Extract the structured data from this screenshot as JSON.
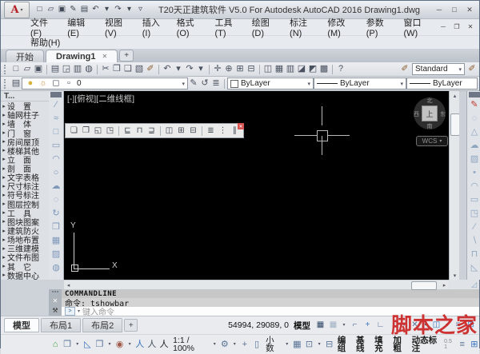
{
  "window": {
    "title": "T20天正建筑软件 V5.0 For Autodesk AutoCAD 2016   Drawing1.dwg",
    "logo_letter": "A",
    "logo_dropdown_icon": "▾",
    "qat": [
      {
        "name": "qat-new-icon",
        "text": "□"
      },
      {
        "name": "qat-open-icon",
        "text": "▱"
      },
      {
        "name": "qat-save-icon",
        "text": "▣"
      },
      {
        "name": "qat-saveas-icon",
        "text": "✎"
      },
      {
        "name": "qat-plot-icon",
        "text": "▤"
      },
      {
        "name": "qat-undo-icon",
        "text": "↶"
      },
      {
        "name": "qat-undo-dropdown-icon",
        "text": "▾"
      },
      {
        "name": "qat-redo-icon",
        "text": "↷"
      },
      {
        "name": "qat-redo-dropdown-icon",
        "text": "▾"
      },
      {
        "name": "qat-customize-icon",
        "text": "▿"
      }
    ],
    "controls": [
      {
        "name": "minimize-button",
        "text": "─"
      },
      {
        "name": "maximize-button",
        "text": "□"
      },
      {
        "name": "close-button",
        "text": "✕"
      }
    ],
    "doc_controls": [
      {
        "name": "doc-minimize-button",
        "text": "─"
      },
      {
        "name": "doc-restore-button",
        "text": "❐"
      },
      {
        "name": "doc-close-button",
        "text": "✕"
      }
    ]
  },
  "menu": {
    "items": [
      {
        "name": "menu-file",
        "text": "文件(F)"
      },
      {
        "name": "menu-edit",
        "text": "编辑(E)"
      },
      {
        "name": "menu-view",
        "text": "视图(V)"
      },
      {
        "name": "menu-insert",
        "text": "插入(I)"
      },
      {
        "name": "menu-format",
        "text": "格式(O)"
      },
      {
        "name": "menu-tools",
        "text": "工具(T)"
      },
      {
        "name": "menu-draw",
        "text": "绘图(D)"
      },
      {
        "name": "menu-dimension",
        "text": "标注(N)"
      },
      {
        "name": "menu-modify",
        "text": "修改(M)"
      },
      {
        "name": "menu-parameters",
        "text": "参数(P)"
      },
      {
        "name": "menu-window",
        "text": "窗口(W)"
      }
    ],
    "row2": [
      {
        "name": "menu-help",
        "text": "帮助(H)"
      }
    ]
  },
  "file_tabs": {
    "start_label": "开始",
    "drawing_label": "Drawing1",
    "close_icon": "✕",
    "new_tab_icon": "+"
  },
  "toolbar_standard": {
    "icons": [
      {
        "name": "new-icon",
        "text": "□"
      },
      {
        "name": "open-icon",
        "text": "▱"
      },
      {
        "name": "save-icon",
        "text": "▣"
      },
      {
        "sep": true
      },
      {
        "name": "print-icon",
        "text": "▤"
      },
      {
        "name": "print-preview-icon",
        "text": "◲"
      },
      {
        "name": "publish-icon",
        "text": "▥"
      },
      {
        "name": "etransmit-icon",
        "text": "◍"
      },
      {
        "sep": true
      },
      {
        "name": "cut-icon",
        "text": "✂"
      },
      {
        "name": "copy-icon",
        "text": "❐"
      },
      {
        "name": "paste-icon",
        "text": "❑"
      },
      {
        "name": "match-properties-icon",
        "text": "▧"
      },
      {
        "name": "blockeditor-icon",
        "text": "✐",
        "color": "#8a5a2b"
      },
      {
        "sep": true
      },
      {
        "name": "undo-icon",
        "text": "↶"
      },
      {
        "name": "undo-dropdown-icon",
        "text": "▾"
      },
      {
        "name": "redo-icon",
        "text": "↷"
      },
      {
        "name": "redo-dropdown-icon",
        "text": "▾"
      },
      {
        "sep": true
      },
      {
        "name": "pan-icon",
        "text": "✛"
      },
      {
        "name": "zoom-realtime-icon",
        "text": "⊕"
      },
      {
        "name": "zoom-window-icon",
        "text": "⊞"
      },
      {
        "name": "zoom-previous-icon",
        "text": "⊟"
      },
      {
        "sep": true
      },
      {
        "name": "properties-icon",
        "text": "◫"
      },
      {
        "name": "designcenter-icon",
        "text": "▦"
      },
      {
        "name": "toolpalettes-icon",
        "text": "▥"
      },
      {
        "name": "sheetset-icon",
        "text": "◪"
      },
      {
        "name": "markup-icon",
        "text": "◩"
      },
      {
        "name": "quickcalc-icon",
        "text": "▩"
      },
      {
        "sep": true
      },
      {
        "name": "help-icon",
        "text": "?"
      }
    ],
    "brush_left_icon": "✐",
    "style_value": "Standard",
    "style_dropdown_icon": "▾",
    "brush_right_icon": "✐"
  },
  "toolbar_properties": {
    "layer_manager_icon": "▤",
    "layer_swatch_icons": [
      {
        "name": "bulb-icon",
        "text": "●",
        "color": "#d9b23c",
        "ia": false
      },
      {
        "name": "sun-icon",
        "text": "☼",
        "color": "#d98e3c",
        "ia": false
      },
      {
        "name": "lock-icon",
        "text": "◻",
        "ia": false
      },
      {
        "name": "color-swatch",
        "text": "▫",
        "ia": false
      }
    ],
    "layer_value": "0",
    "make_layer_current_icon": "✎",
    "layer_previous_icon": "↺",
    "layer_states_icon": "≣",
    "color_value": "ByLayer",
    "linetype_value": "ByLayer",
    "lineweight_value": "ByLayer"
  },
  "sidebar": {
    "title": "T...",
    "arrow_icon": "▸",
    "items": [
      "设　置",
      "轴网柱子",
      "墙　体",
      "门　窗",
      "房间屋顶",
      "楼梯其他",
      "立　面",
      "剖　面",
      "文字表格",
      "尺寸标注",
      "符号标注",
      "图层控制",
      "工　具",
      "图块图案",
      "建筑防火",
      "场地布置",
      "三维建模",
      "文件布图",
      "其　它",
      "数据中心"
    ]
  },
  "draw_toolbar": {
    "icons": [
      {
        "name": "line-icon",
        "text": "∕"
      },
      {
        "name": "spline-icon",
        "text": "≈"
      },
      {
        "name": "rect-icon",
        "text": "□"
      },
      {
        "name": "polygon-icon",
        "text": "▭"
      },
      {
        "name": "arc-icon",
        "text": "◠"
      },
      {
        "name": "circle-icon",
        "text": "○"
      },
      {
        "name": "revcloud-icon",
        "text": "☁"
      },
      {
        "name": "ellipse-icon",
        "text": "◌"
      },
      {
        "name": "rotate-icon",
        "text": "↻"
      },
      {
        "name": "copy-icon",
        "text": "❐"
      },
      {
        "name": "array-icon",
        "text": "▦"
      },
      {
        "name": "hatch-icon",
        "text": "▨"
      },
      {
        "name": "gradient-icon",
        "text": "◍"
      }
    ]
  },
  "modify_toolbar": {
    "icons": [
      {
        "name": "pencil-icon",
        "text": "✎",
        "color": "#c0392b"
      },
      {
        "name": "erase-icon",
        "text": "◌"
      },
      {
        "name": "mirror-icon",
        "text": "△"
      },
      {
        "name": "cloud-icon",
        "text": "☁"
      },
      {
        "name": "hatch-icon",
        "text": "▨"
      },
      {
        "name": "point-icon",
        "text": "•"
      },
      {
        "name": "arc-icon",
        "text": "◠"
      },
      {
        "name": "rect-icon",
        "text": "▭"
      },
      {
        "name": "move-icon",
        "text": "◳"
      },
      {
        "name": "trim-icon",
        "text": "∕"
      },
      {
        "name": "extend-icon",
        "text": "∖"
      },
      {
        "name": "offset-icon",
        "text": "⊓"
      },
      {
        "name": "corner-icon",
        "text": "◺"
      }
    ]
  },
  "canvas": {
    "viewport_label": "[-][俯视][二维线框]",
    "float_toolbar": {
      "close_icon": "✕",
      "icons": [
        {
          "name": "object-copy-icon",
          "text": "❏"
        },
        {
          "name": "object-move-icon",
          "text": "❐"
        },
        {
          "name": "align-bottom-icon",
          "text": "◱"
        },
        {
          "name": "align-top-icon",
          "text": "◳"
        },
        {
          "sep": true
        },
        {
          "name": "align-left-icon",
          "text": "⊑"
        },
        {
          "name": "align-center-icon",
          "text": "⊓"
        },
        {
          "name": "align-right-icon",
          "text": "⊒"
        },
        {
          "sep": true
        },
        {
          "name": "distribute-h-icon",
          "text": "◫"
        },
        {
          "name": "distribute-v-icon",
          "text": "⊞"
        },
        {
          "name": "equal-space-icon",
          "text": "⊟"
        },
        {
          "sep": true
        },
        {
          "name": "list-icon",
          "text": "≣"
        },
        {
          "name": "columns-icon",
          "text": "⋮"
        },
        {
          "name": "parallel-icon",
          "text": "∥"
        }
      ]
    },
    "ucs": {
      "x_label": "X",
      "y_label": "Y"
    },
    "viewcube": {
      "top": "上",
      "north": "北",
      "south": "南",
      "east": "东",
      "west": "西"
    },
    "wcs_label": "WCS",
    "wcs_dropdown_icon": "▾"
  },
  "scrollbars": {
    "up_icon": "▴",
    "down_icon": "▾",
    "left_icon": "◂",
    "right_icon": "▸",
    "corner_icon": "◿"
  },
  "commandline": {
    "close_icon": "✕",
    "customize_icon": "⚒",
    "title": "COMMANDLINE",
    "history": "命令: tshowbar",
    "prompt_icon": ">",
    "dropdown_icon": "▾",
    "placeholder": "键入命令"
  },
  "layout_tabs": {
    "tabs": [
      "模型",
      "布局1",
      "布局2"
    ],
    "new_layout_icon": "+"
  },
  "status": {
    "coords": "54994, 29089, 0",
    "model_label": "模型",
    "right_icons": [
      {
        "name": "grid-display-icon",
        "text": "▦",
        "color": "#2d4564"
      },
      {
        "name": "snap-grid-icon",
        "text": "▦",
        "color": "#9fb0c2"
      },
      {
        "name": "grid-dropdown-icon",
        "text": "▾",
        "cls": "dd2"
      },
      {
        "name": "snap-mode-icon",
        "text": "⌐"
      },
      {
        "name": "dynamic-input-icon",
        "text": "+",
        "color": "#3a74c0"
      },
      {
        "name": "ortho-icon",
        "text": "∟"
      },
      {
        "name": "polar-tracking-icon",
        "text": "◔"
      },
      {
        "name": "polar-dropdown-icon",
        "text": "▾",
        "cls": "dd2"
      },
      {
        "name": "osnap-icon",
        "text": "✕"
      },
      {
        "name": "osnap-dropdown-icon",
        "text": "▾",
        "cls": "dd2"
      },
      {
        "name": "annotation-visibility-icon",
        "text": "◫",
        "color": "#3a74c0"
      },
      {
        "name": "annotation-dropdown-icon",
        "text": "▾",
        "cls": "dd2"
      },
      {
        "name": "customization-icon",
        "text": "≡"
      },
      {
        "name": "clean-screen-icon",
        "text": "⊞",
        "color": "#3a74c0"
      }
    ],
    "row2_icons": [
      {
        "name": "tz-object-icon",
        "text": "⌂",
        "color": "#3f9e3f"
      },
      {
        "name": "workspace-icon",
        "text": "❒"
      },
      {
        "name": "workspace-dropdown-icon",
        "text": "▾",
        "cls": "dd2"
      },
      {
        "name": "tz-view-icon",
        "text": "◺",
        "color": "#3a74c0"
      },
      {
        "name": "box-mode-icon",
        "text": "❒"
      },
      {
        "name": "box-dropdown-icon",
        "text": "▾",
        "cls": "dd2"
      },
      {
        "name": "visual-style-icon",
        "text": "◉",
        "color": "#a05a4a"
      },
      {
        "name": "visual-dropdown-icon",
        "text": "▾",
        "cls": "dd2"
      },
      {
        "name": "walk-icon-1",
        "text": "人",
        "color": "#3a74c0"
      },
      {
        "name": "walk-icon-2",
        "text": "人",
        "color": "#44505e"
      },
      {
        "name": "walk-icon-3",
        "text": "人",
        "color": "#222"
      },
      {
        "name": "scale-label",
        "text": "1:1 / 100%",
        "cls": "txtb"
      },
      {
        "name": "scale-dropdown-icon",
        "text": "▾",
        "cls": "dd2"
      },
      {
        "name": "gear-icon",
        "text": "⚙"
      },
      {
        "name": "gear-dropdown-icon",
        "text": "▾",
        "cls": "dd2"
      },
      {
        "name": "add-scale-icon",
        "text": "+"
      },
      {
        "name": "isolate-icon",
        "text": "▯"
      },
      {
        "name": "precision-label",
        "text": "小数",
        "cls": "txtb"
      },
      {
        "name": "precision-dropdown-icon",
        "text": "▾",
        "cls": "dd2"
      },
      {
        "name": "calc-icon",
        "text": "▦"
      },
      {
        "name": "monitor-icon",
        "text": "⊡"
      },
      {
        "name": "monitor-dropdown-icon",
        "text": "▾",
        "cls": "dd2"
      },
      {
        "name": "tz-status-icon",
        "text": "⊟"
      },
      {
        "name": "toggle-group",
        "text": "编组",
        "cls": "tgl"
      },
      {
        "name": "toggle-baseline",
        "text": "基线",
        "cls": "tgl"
      },
      {
        "name": "toggle-fill",
        "text": "填充",
        "cls": "tgl"
      },
      {
        "name": "toggle-bold",
        "text": "加粗",
        "cls": "tgl"
      },
      {
        "name": "toggle-dynamic-dim",
        "text": "动态标注",
        "cls": "tgl"
      },
      {
        "name": "annotation-scale-values",
        "text": "0.5 1",
        "cls": "tiny",
        "ia": false
      },
      {
        "name": "hamburger-icon",
        "text": "≡"
      },
      {
        "name": "fullscreen-icon",
        "text": "⊞",
        "color": "#3a74c0"
      }
    ]
  },
  "watermark": {
    "text": "脚本之家"
  }
}
